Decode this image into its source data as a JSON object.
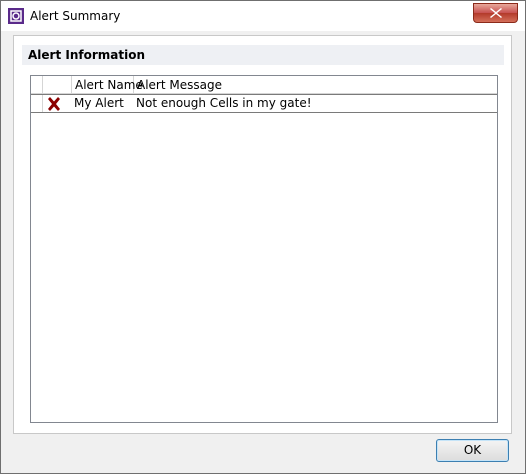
{
  "window": {
    "title": "Alert Summary",
    "close_icon": "close-icon"
  },
  "group": {
    "header": "Alert Information"
  },
  "grid": {
    "columns": [
      "",
      "Alert Name",
      "Alert Message"
    ],
    "rows": [
      {
        "status_icon": "error-x-icon",
        "name": "My Alert",
        "message": "Not enough Cells in my gate!"
      }
    ]
  },
  "footer": {
    "ok_label": "OK"
  },
  "colors": {
    "error_icon": "#8b0000",
    "ok_border": "#3c7fb1"
  }
}
